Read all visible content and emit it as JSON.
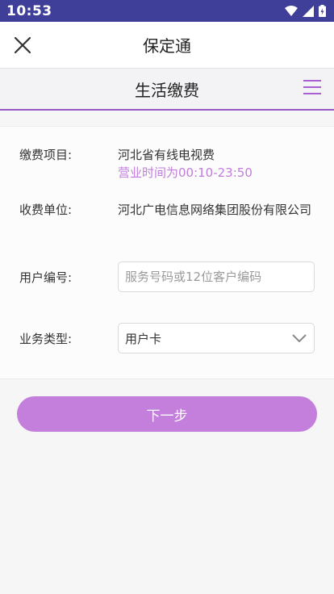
{
  "status_bar": {
    "time": "10:53"
  },
  "app_bar": {
    "title": "保定通",
    "close_icon": "close-icon"
  },
  "section": {
    "title": "生活缴费",
    "menu_icon": "hamburger-menu-icon"
  },
  "form": {
    "item_label": "缴费项目:",
    "item_value": "河北省有线电视费",
    "business_hours": "营业时间为00:10-23:50",
    "unit_label": "收费单位:",
    "unit_value": "河北广电信息网络集团股份有限公司",
    "user_no_label": "用户编号:",
    "user_no_placeholder": "服务号码或12位客户编码",
    "user_no_value": "",
    "biz_type_label": "业务类型:",
    "biz_type_value": "用户卡"
  },
  "actions": {
    "next_label": "下一步"
  },
  "colors": {
    "status_bar": "#3f3f9a",
    "accent": "#9a58c6",
    "button": "#c47fdc",
    "hours_text": "#c07ddb"
  }
}
